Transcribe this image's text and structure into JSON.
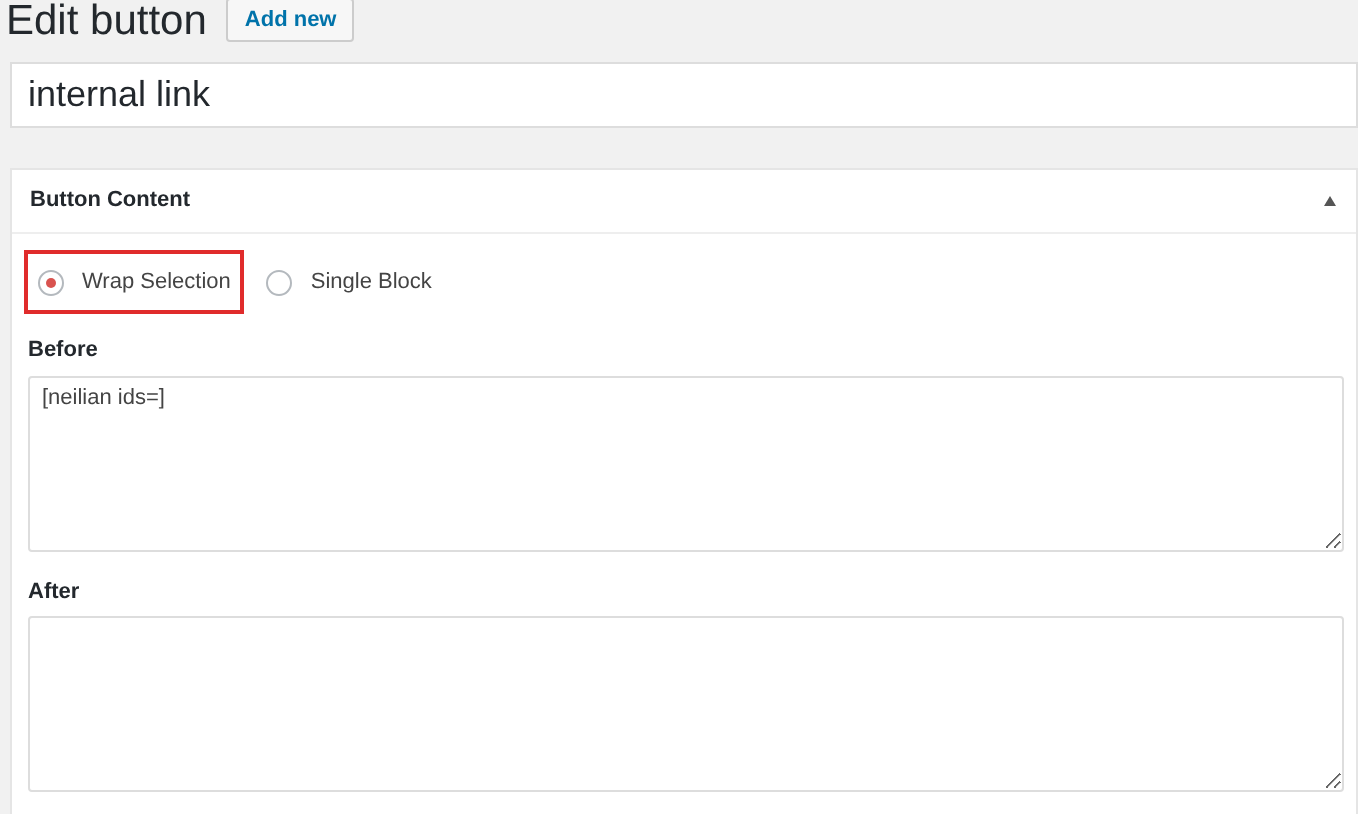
{
  "page": {
    "title": "Edit button",
    "add_new": "Add new"
  },
  "title_field": {
    "value": "internal link"
  },
  "panel": {
    "title": "Button Content",
    "expanded": true,
    "options": [
      {
        "label": "Wrap Selection",
        "selected": true,
        "highlighted": true
      },
      {
        "label": "Single Block",
        "selected": false,
        "highlighted": false
      }
    ],
    "fields": [
      {
        "label": "Before",
        "value": "[neilian ids=]"
      },
      {
        "label": "After"
      }
    ]
  }
}
